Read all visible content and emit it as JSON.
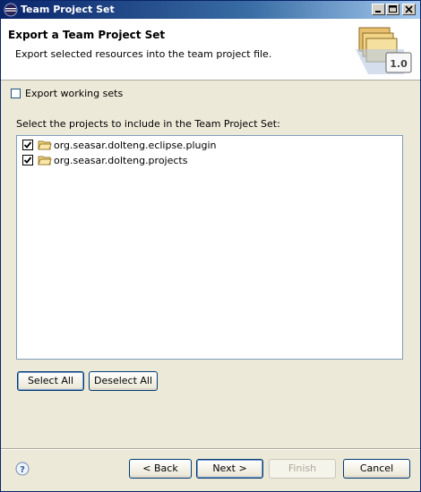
{
  "window": {
    "title": "Team Project Set",
    "controls": {
      "minimize_icon": "minimize-icon",
      "maximize_icon": "maximize-icon",
      "close_icon": "close-icon"
    }
  },
  "header": {
    "title": "Export a Team Project Set",
    "description": "Export selected resources into the team project file.",
    "wizard_image_label": "1.0"
  },
  "export_working_sets": {
    "label": "Export working sets",
    "checked": false
  },
  "projects": {
    "label": "Select the projects to include in the Team Project Set:",
    "items": [
      {
        "label": "org.seasar.dolteng.eclipse.plugin",
        "checked": true
      },
      {
        "label": "org.seasar.dolteng.projects",
        "checked": true
      }
    ]
  },
  "buttons": {
    "select_all": "Select All",
    "deselect_all": "Deselect All",
    "back": "< Back",
    "next": "Next >",
    "finish": "Finish",
    "cancel": "Cancel"
  },
  "colors": {
    "title_bar": "#0a246a",
    "header_bg": "#ffffff",
    "dialog_bg": "#ece9d8"
  }
}
